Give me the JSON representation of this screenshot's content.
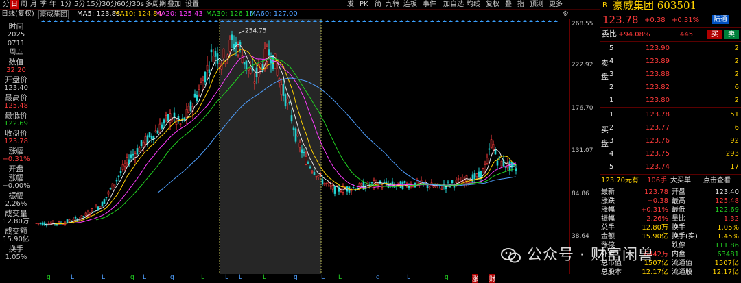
{
  "toolbar": {
    "left_items": [
      "分",
      "日",
      "周",
      "月",
      "季",
      "年",
      "1分",
      "5分",
      "15分",
      "30分",
      "60分",
      "30s",
      "多周期",
      "叠加",
      "设置"
    ],
    "selected": "日",
    "right_items": [
      "发",
      "PK",
      "简",
      "九转",
      "连板",
      "事件",
      "加自选",
      "均线",
      "复权",
      "叠",
      "指",
      "预测",
      "更多"
    ]
  },
  "ma_bar": {
    "title": "日线(复权)",
    "stock": "豪威集团",
    "ma5": "MA5: 123.83",
    "ma10": "MA10: 124.84",
    "ma20": "MA20: 125.43",
    "ma30": "MA30: 126.16",
    "ma60": "MA60: 127.00"
  },
  "left_info": [
    {
      "label": "时间",
      "value": "2025",
      "value2": "0711",
      "value3": "周五",
      "vcolor": "#c8c8c8"
    },
    {
      "label": "数值",
      "value": "32.20",
      "vcolor": "#ff3b3b"
    },
    {
      "label": "开盘价",
      "value": "123.40",
      "vcolor": "#c8c8c8"
    },
    {
      "label": "最高价",
      "value": "125.48",
      "vcolor": "#ff3b3b"
    },
    {
      "label": "最低价",
      "value": "122.69",
      "vcolor": "#22d322"
    },
    {
      "label": "收盘价",
      "value": "123.78",
      "vcolor": "#ff3b3b"
    },
    {
      "label": "涨幅",
      "value": "+0.31%",
      "vcolor": "#ff3b3b"
    },
    {
      "label": "开盘涨幅",
      "value": "+0.00%",
      "vcolor": "#c8c8c8"
    },
    {
      "label": "振幅",
      "value": "2.26%",
      "vcolor": "#c8c8c8"
    },
    {
      "label": "成交量",
      "value": "12.80万",
      "vcolor": "#c8c8c8"
    },
    {
      "label": "成交额",
      "value": "15.90亿",
      "vcolor": "#c8c8c8"
    },
    {
      "label": "换手",
      "value": "1.05%",
      "vcolor": "#c8c8c8"
    }
  ],
  "price_axis": [
    "268.55",
    "222.92",
    "176.70",
    "131.07",
    "84.86",
    "38.64"
  ],
  "chart_data": {
    "type": "candlestick",
    "y_range": [
      38.64,
      268.55
    ],
    "highlighted_high": "254.75",
    "last_close": 123.78,
    "ma_colors": {
      "ma5": "#e8e8e8",
      "ma10": "#ffd200",
      "ma20": "#ff3bff",
      "ma30": "#22d322",
      "ma60": "#4fa0ff"
    }
  },
  "bottom_markers": [
    "q",
    "L",
    "L",
    "q",
    "L",
    "q",
    "L",
    "L",
    "L",
    "L",
    "q",
    "L",
    "L",
    "q",
    "L",
    "q",
    "涨",
    "财"
  ],
  "right": {
    "flag": "R",
    "title": "豪威集团 603501",
    "price": "123.78",
    "change": "+0.38",
    "change_pct": "+0.31%",
    "tag": "陆通",
    "weibi_label": "委比",
    "weibi_value": "+94.08%",
    "weicha": "445",
    "buy_btn": "买",
    "sell_btn": "卖",
    "sell_side_label": [
      "卖",
      "盘"
    ],
    "buy_side_label": [
      "买",
      "盘"
    ],
    "asks": [
      {
        "level": "5",
        "price": "123.90",
        "vol": "2"
      },
      {
        "level": "4",
        "price": "123.89",
        "vol": "2"
      },
      {
        "level": "3",
        "price": "123.88",
        "vol": "2"
      },
      {
        "level": "2",
        "price": "123.82",
        "vol": "6"
      },
      {
        "level": "1",
        "price": "123.80",
        "vol": "2"
      }
    ],
    "bids": [
      {
        "level": "1",
        "price": "123.78",
        "vol": "51"
      },
      {
        "level": "2",
        "price": "123.77",
        "vol": "6"
      },
      {
        "level": "3",
        "price": "123.76",
        "vol": "92"
      },
      {
        "level": "4",
        "price": "123.75",
        "vol": "293"
      },
      {
        "level": "5",
        "price": "123.74",
        "vol": "17"
      }
    ],
    "bigorder": {
      "price": "123.70元有",
      "vol": "106手",
      "label": "大买单",
      "link": "点击查看"
    },
    "stats": [
      {
        "l1": "最新",
        "v1": "123.78",
        "c1": "red",
        "l2": "开盘",
        "v2": "123.40",
        "c2": "white"
      },
      {
        "l1": "涨跌",
        "v1": "+0.38",
        "c1": "red",
        "l2": "最高",
        "v2": "125.48",
        "c2": "red"
      },
      {
        "l1": "涨幅",
        "v1": "+0.31%",
        "c1": "red",
        "l2": "最低",
        "v2": "122.69",
        "c2": "green"
      },
      {
        "l1": "振幅",
        "v1": "2.26%",
        "c1": "red",
        "l2": "量比",
        "v2": "1.32",
        "c2": "red"
      },
      {
        "l1": "总手",
        "v1": "12.80万",
        "c1": "yellow",
        "l2": "换手",
        "v2": "1.05%",
        "c2": "yellow"
      },
      {
        "l1": "金额",
        "v1": "15.90亿",
        "c1": "yellow",
        "l2": "换手(实)",
        "v2": "1.45%",
        "c2": "yellow"
      },
      {
        "l1": "涨停",
        "v1": "",
        "c1": "red",
        "l2": "跌停",
        "v2": "111.86",
        "c2": "green"
      },
      {
        "l1": "外盘",
        "v1": "6442万",
        "c1": "red",
        "l2": "内盘",
        "v2": "63481",
        "c2": "green"
      },
      {
        "l1": "总市值",
        "v1": "1507亿",
        "c1": "yellow",
        "l2": "流通值",
        "v2": "1507亿",
        "c2": "yellow"
      },
      {
        "l1": "总股本",
        "v1": "12.17亿",
        "c1": "yellow",
        "l2": "流通股",
        "v2": "12.17亿",
        "c2": "yellow"
      }
    ]
  },
  "watermark": "公众号 · 财富闲兽"
}
